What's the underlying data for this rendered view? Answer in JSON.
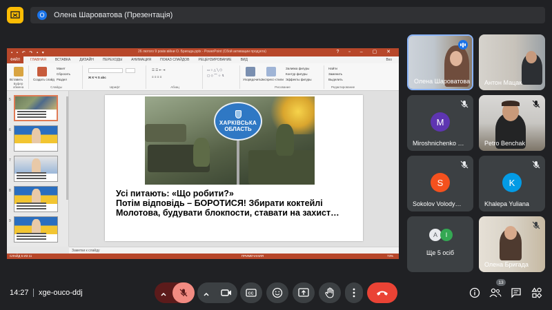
{
  "meeting": {
    "presenting_banner": "Олена Шароватова (Презентація)",
    "presenter_initial": "О",
    "time": "14:27",
    "meeting_code": "xge-ouco-ddj",
    "participants_count": "13"
  },
  "powerpoint": {
    "window_title": "26 лютого 9 років війни О. Бригада.pptx - PowerPoint (Сбой активации продукта)",
    "tabs": [
      "ФАЙЛ",
      "ГЛАВНАЯ",
      "ВСТАВКА",
      "ДИЗАЙН",
      "ПЕРЕХОДЫ",
      "АНИМАЦИЯ",
      "ПОКАЗ СЛАЙДОВ",
      "РЕЦЕНЗИРОВАНИЕ",
      "ВИД"
    ],
    "login_label": "Вхо",
    "ribbon": {
      "clipboard_group": "Буфер обмена",
      "slides_group": "Слайды",
      "font_group": "Шрифт",
      "paragraph_group": "Абзац",
      "drawing_group": "Рисование",
      "editing_group": "Редактирование",
      "paste_label": "Вставить",
      "new_slide_label": "Создать слайд",
      "layout_label": "Макет",
      "reset_label": "Сбросить",
      "section_label": "Раздел",
      "arrange_label": "Упорядочить",
      "quick_styles_label": "Экспресс-стили",
      "shape_fill_label": "Заливка фигуры",
      "shape_outline_label": "Контур фигуры",
      "shape_effects_label": "Эффекты фигуры",
      "find_label": "Найти",
      "replace_label": "Заменить",
      "select_label": "Выделить"
    },
    "thumbnail_numbers": [
      "5",
      "6",
      "7",
      "8",
      "9"
    ],
    "slide": {
      "sign_line1": "ХАРКІВСЬКА",
      "sign_line2": "ОБЛАСТЬ",
      "line1": "Усі питають: «Що робити?»",
      "line2": "Потім відповідь – БОРОТИСЯ! Збирати коктейлі Молотова, будувати блокпости, ставати на захист…"
    },
    "notes_placeholder": "Заметки к слайду",
    "status_slide": "СЛАЙД 5 ИЗ 11",
    "status_notes": "ПРИМЕЧАНИЯ",
    "zoom": "73%"
  },
  "participants": [
    {
      "name": "Олена Шароватова",
      "type": "video",
      "speaking": true
    },
    {
      "name": "Антон Мацак",
      "type": "video",
      "muted": false
    },
    {
      "name": "Miroshnichenko …",
      "type": "avatar",
      "initial": "M",
      "color": "#5e35b1",
      "muted": true
    },
    {
      "name": "Petro Benchak",
      "type": "video",
      "muted": true
    },
    {
      "name": "Sokolov Volody…",
      "type": "avatar",
      "initial": "S",
      "color": "#f4511e",
      "muted": true
    },
    {
      "name": "Khalepa Yuliana",
      "type": "avatar",
      "initial": "K",
      "color": "#039be5",
      "muted": true
    },
    {
      "name": "Ще 5 осіб",
      "type": "more",
      "initials": [
        "A",
        "I"
      ]
    },
    {
      "name": "Олена Бригада",
      "type": "video",
      "muted": true
    }
  ],
  "colors": {
    "background": "#202124",
    "tile": "#3c4043",
    "accent_blue": "#8ab4f8",
    "end_call": "#ea4335",
    "ppt_red": "#b7472a",
    "present_yellow": "#fbbc04"
  },
  "icons": {
    "present": "present-to-all-icon",
    "mic_off": "mic-off-icon",
    "camera": "videocam-icon",
    "captions": "closed-captions-icon",
    "emoji": "emoji-icon",
    "present_now": "present-now-icon",
    "raise_hand": "raise-hand-icon",
    "more": "more-vert-icon",
    "end_call": "call-end-icon",
    "info": "info-icon",
    "people": "people-icon",
    "chat": "chat-icon",
    "activities": "activities-icon"
  }
}
